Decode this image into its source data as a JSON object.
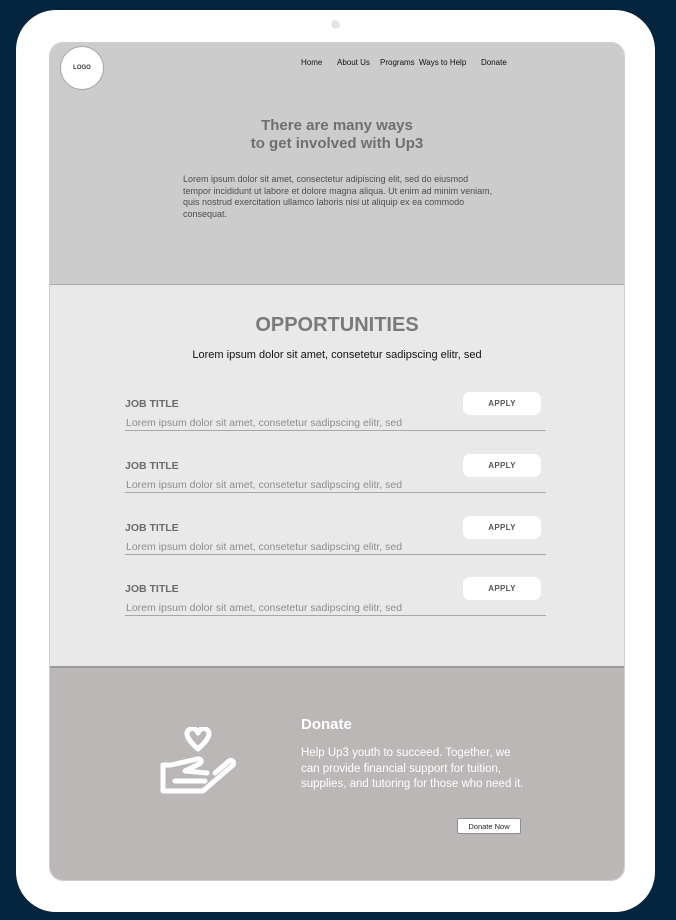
{
  "header": {
    "logo_text": "LOGO",
    "nav": [
      "Home",
      "About Us",
      "Programs",
      "Ways to Help",
      "Donate"
    ]
  },
  "hero": {
    "title_line1": "There are many ways",
    "title_line2": "to get involved with Up3",
    "body": "Lorem ipsum dolor sit amet, consectetur adipiscing elit, sed do eiusmod tempor incididunt ut labore et dolore magna aliqua. Ut enim ad minim veniam, quis nostrud exercitation ullamco laboris nisi ut aliquip ex ea commodo consequat."
  },
  "opportunities": {
    "title": "OPPORTUNITIES",
    "subtitle": "Lorem ipsum dolor sit amet, consetetur sadipscing elitr, sed",
    "jobs": [
      {
        "title": "JOB TITLE",
        "desc": "Lorem ipsum dolor sit amet, consetetur sadipscing elitr, sed",
        "button": "APPLY"
      },
      {
        "title": "JOB TITLE",
        "desc": "Lorem ipsum dolor sit amet, consetetur sadipscing elitr, sed",
        "button": "APPLY"
      },
      {
        "title": "JOB TITLE",
        "desc": "Lorem ipsum dolor sit amet, consetetur sadipscing elitr, sed",
        "button": "APPLY"
      },
      {
        "title": "JOB TITLE",
        "desc": "Lorem ipsum dolor sit amet, consetetur sadipscing elitr, sed",
        "button": "APPLY"
      }
    ]
  },
  "donate": {
    "icon": "heart-in-hand-icon",
    "title": "Donate",
    "body": "Help Up3 youth to succeed. Together, we can provide financial support for tuition, supplies, and tutoring for those who need it.",
    "button": "Donate Now"
  },
  "colors": {
    "frame_background": "#05253f",
    "hero_background": "#cccccc",
    "opportunities_background": "#e9e9e9",
    "donate_background": "#bab7b6"
  }
}
